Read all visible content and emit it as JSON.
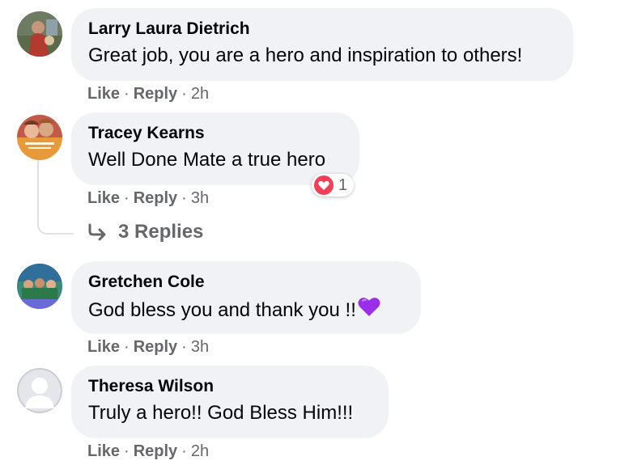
{
  "comments": [
    {
      "author": "Larry Laura Dietrich",
      "text": "Great job, you are a hero and inspiration to others!",
      "like": "Like",
      "reply": "Reply",
      "time": "2h"
    },
    {
      "author": "Tracey Kearns",
      "text": "Well Done Mate a true hero",
      "like": "Like",
      "reply": "Reply",
      "time": "3h",
      "reaction": {
        "icon": "love-reaction-icon",
        "count": "1",
        "color": "#f33e58"
      }
    },
    {
      "author": "Gretchen Cole",
      "text": "God bless you and thank you !!",
      "emoji": "purple-heart-icon",
      "like": "Like",
      "reply": "Reply",
      "time": "3h"
    },
    {
      "author": "Theresa Wilson",
      "text": "Truly a hero!! God Bless Him!!!",
      "like": "Like",
      "reply": "Reply",
      "time": "2h"
    }
  ],
  "replies": {
    "label": "3 Replies",
    "icon": "reply-arrow-icon"
  },
  "separator": "·",
  "colors": {
    "bubble": "#f0f2f5",
    "meta_text": "#65676b",
    "body_text": "#050505",
    "love": "#f33e58",
    "purple_heart": "#9b2ee8"
  }
}
